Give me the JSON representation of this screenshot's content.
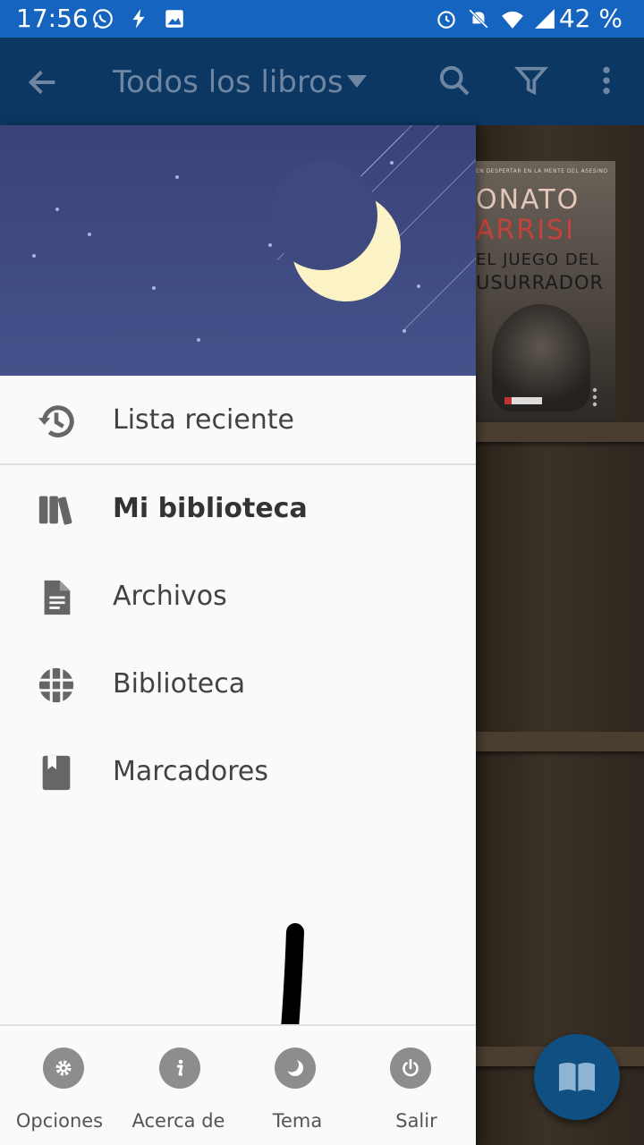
{
  "status_bar": {
    "time": "17:56",
    "battery": "42 %",
    "left_icons": [
      "whatsapp-icon",
      "flash-icon",
      "image-icon"
    ],
    "right_icons": [
      "alarm-icon",
      "mute-icon",
      "wifi-icon",
      "signal-icon"
    ]
  },
  "app_bar": {
    "title": "Todos los libros",
    "icons": [
      "back-arrow-icon",
      "dropdown-caret-icon",
      "search-icon",
      "filter-icon",
      "more-vert-icon"
    ]
  },
  "background_book": {
    "top_tag": "EN DESPERTAR EN LA MENTE DEL ASESINO",
    "author_line1": "ONATO",
    "author_line2": "ARRISI",
    "title_line1": "EL JUEGO DEL",
    "title_line2": "USURRADOR"
  },
  "drawer": {
    "header_illustration": "night-sky-moon",
    "recent": {
      "label": "Lista reciente",
      "icon": "history-icon"
    },
    "items": [
      {
        "label": "Mi biblioteca",
        "icon": "books-icon",
        "active": true
      },
      {
        "label": "Archivos",
        "icon": "file-document-icon",
        "active": false
      },
      {
        "label": "Biblioteca",
        "icon": "globe-icon",
        "active": false
      },
      {
        "label": "Marcadores",
        "icon": "bookmark-icon",
        "active": false
      }
    ],
    "bottom_actions": [
      {
        "label": "Opciones",
        "icon": "gear-icon"
      },
      {
        "label": "Acerca de",
        "icon": "info-icon"
      },
      {
        "label": "Tema",
        "icon": "moon-icon"
      },
      {
        "label": "Salir",
        "icon": "power-icon"
      }
    ]
  },
  "fab": {
    "icon": "open-book-icon"
  },
  "colors": {
    "status_bar": "#1565c0",
    "app_bar_dimmed": "#0d3763",
    "drawer_bg": "#fafafa",
    "header_sky": "#3f4a82",
    "moon": "#fbf3c6",
    "icon_gray": "#8d8d8d",
    "fab": "#0f4f82"
  }
}
